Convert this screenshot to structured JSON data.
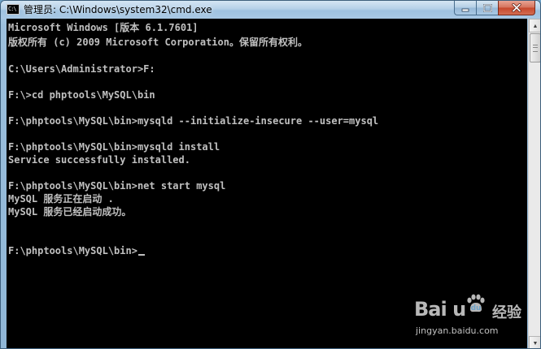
{
  "window": {
    "title": "管理员: C:\\Windows\\system32\\cmd.exe",
    "icon": "cmd-console-icon",
    "icon_glyph": "C:\\"
  },
  "controls": {
    "minimize": "minimize-icon",
    "maximize": "maximize-icon",
    "close": "close-icon"
  },
  "console": {
    "lines": [
      "Microsoft Windows [版本 6.1.7601]",
      "版权所有 (c) 2009 Microsoft Corporation。保留所有权利。",
      "",
      "C:\\Users\\Administrator>F:",
      "",
      "F:\\>cd phptools\\MySQL\\bin",
      "",
      "F:\\phptools\\MySQL\\bin>mysqld --initialize-insecure --user=mysql",
      "",
      "F:\\phptools\\MySQL\\bin>mysqld install",
      "Service successfully installed.",
      "",
      "F:\\phptools\\MySQL\\bin>net start mysql",
      "MySQL 服务正在启动 .",
      "MySQL 服务已经启动成功。",
      "",
      "",
      "F:\\phptools\\MySQL\\bin>"
    ],
    "text_color": "#c0c0c0",
    "background": "#000000"
  },
  "scrollbar": {
    "up": "▲",
    "down": "▼"
  },
  "watermark": {
    "logo": "Bai  u",
    "paw": "paw-icon",
    "sub": "经验",
    "url": "jingyan.baidu.com"
  }
}
